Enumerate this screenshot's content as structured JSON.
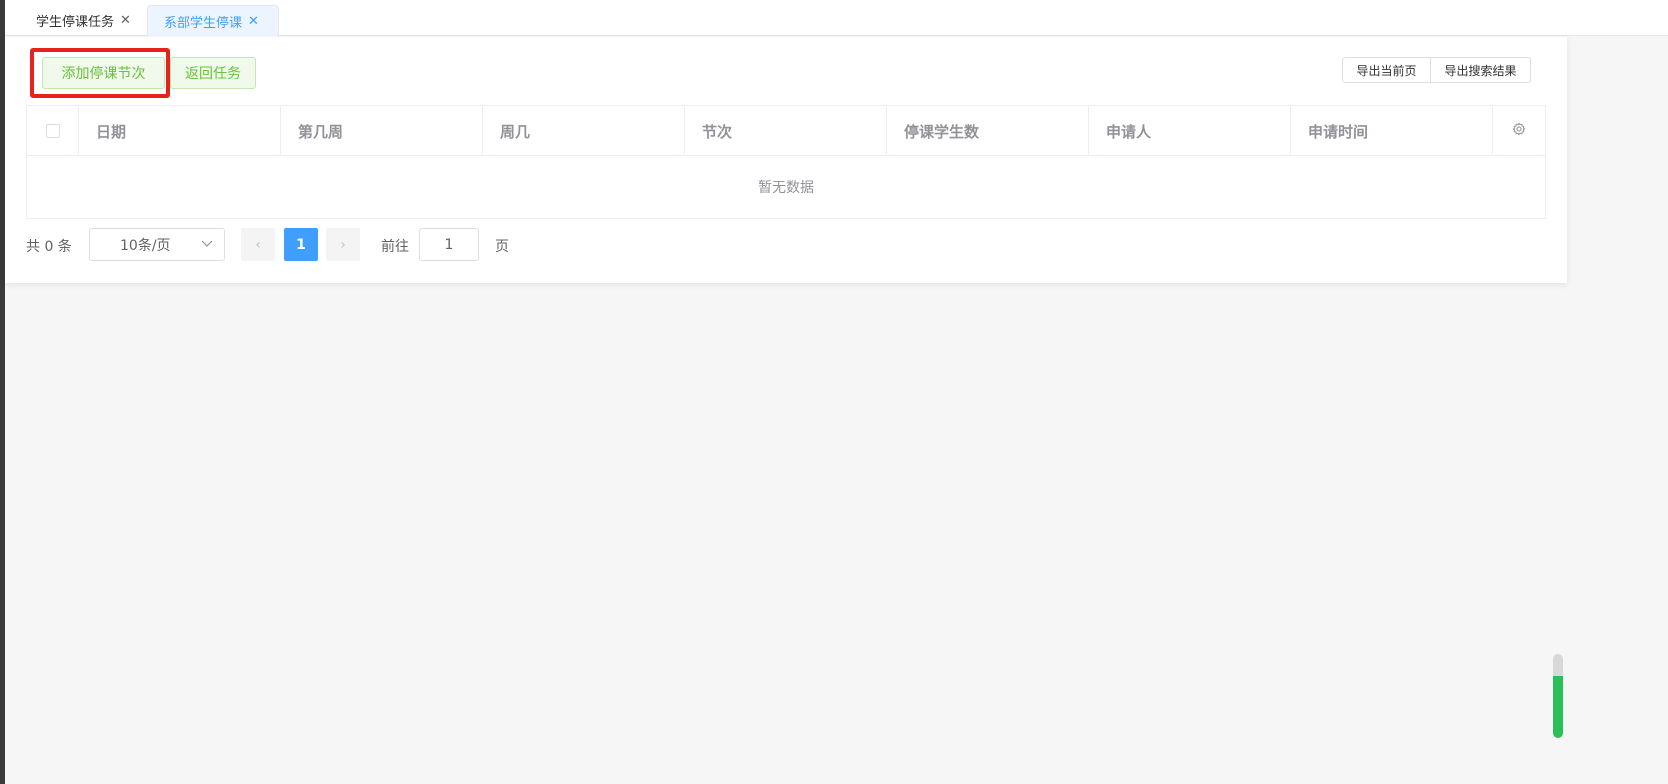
{
  "tabs": [
    {
      "label": "学生停课任务",
      "close": "✕"
    },
    {
      "label": "系部学生停课",
      "close": "✕"
    }
  ],
  "toolbar": {
    "add_label": "添加停课节次",
    "back_label": "返回任务",
    "export_current": "导出当前页",
    "export_search": "导出搜索结果"
  },
  "table": {
    "columns": [
      "日期",
      "第几周",
      "周几",
      "节次",
      "停课学生数",
      "申请人",
      "申请时间"
    ],
    "empty_text": "暂无数据"
  },
  "pagination": {
    "total": "共 0 条",
    "page_size": "10条/页",
    "prev": "‹",
    "current_page": "1",
    "next": "›",
    "goto_label": "前往",
    "goto_value": "1",
    "page_unit": "页"
  },
  "colors": {
    "accent": "#409eff",
    "success": "#67c23a",
    "highlight": "#e8211a"
  },
  "icons": {
    "tab_close": "close-icon",
    "settings": "gear-icon",
    "dropdown": "chevron-down-icon"
  }
}
